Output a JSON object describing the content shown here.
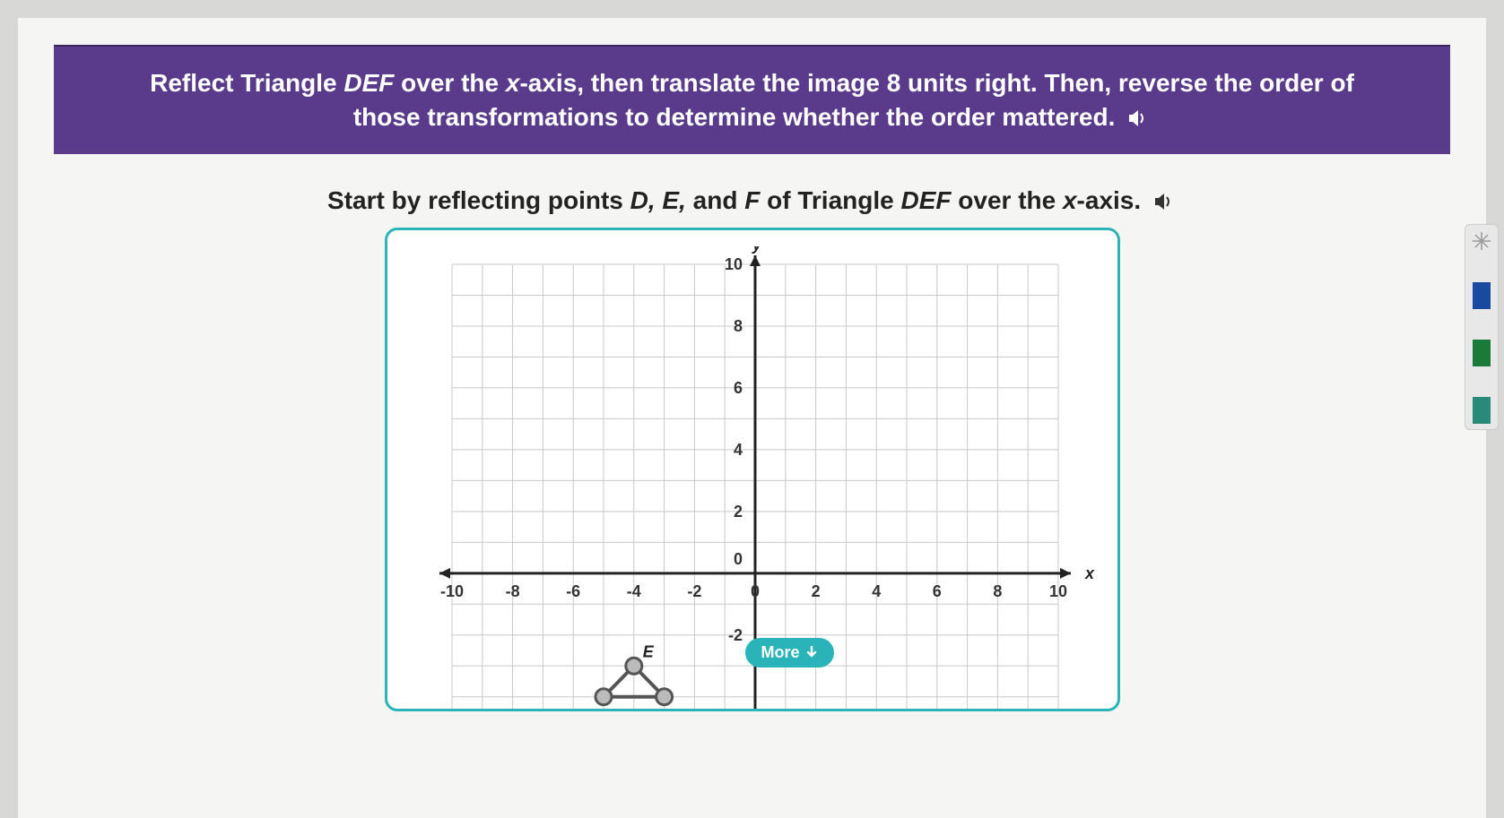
{
  "header": {
    "line1_pre": "Reflect Triangle ",
    "line1_tri": "DEF",
    "line1_mid": " over the ",
    "line1_axis": "x",
    "line1_post": "-axis, then translate the image 8 units right. Then, reverse the order of",
    "line2": "those transformations to determine whether the order mattered."
  },
  "sub": {
    "pre": "Start by reflecting points ",
    "pts": "D, E,",
    "and": " and ",
    "f": "F",
    "mid": " of Triangle ",
    "tri": "DEF",
    "over": " over the ",
    "axis": "x",
    "post": "-axis."
  },
  "more_label": "More",
  "chart_data": {
    "type": "scatter",
    "title": "",
    "xlabel": "x",
    "ylabel": "y",
    "xlim": [
      -10,
      10
    ],
    "ylim": [
      -10,
      10
    ],
    "xticks": [
      -10,
      -8,
      -6,
      -4,
      -2,
      0,
      2,
      4,
      6,
      8,
      10
    ],
    "yticks_visible": [
      10,
      8,
      6,
      4,
      2,
      0,
      -2
    ],
    "grid": true,
    "triangle_DEF": {
      "label_shown": "E",
      "vertices": {
        "D": {
          "x": -5,
          "y": -4
        },
        "E": {
          "x": -4,
          "y": -3
        },
        "F": {
          "x": -3,
          "y": -4
        }
      }
    }
  }
}
